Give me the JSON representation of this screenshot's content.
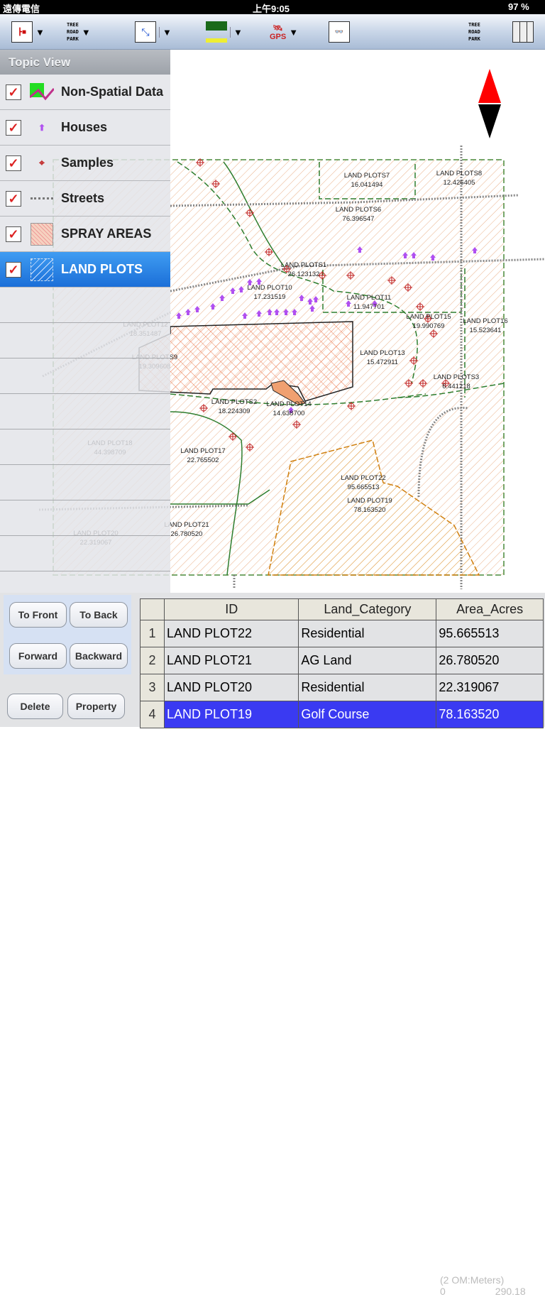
{
  "status": {
    "carrier": "遠傳電信",
    "time": "上午9:05",
    "battery": "97 %"
  },
  "toolbar": {
    "legend_items": [
      "TREE",
      "ROAD",
      "PARK"
    ],
    "gps_label": "GPS",
    "tools": [
      "topic-tree",
      "layer-legend",
      "zoom-extent",
      "measure",
      "gps",
      "query"
    ]
  },
  "sidebar": {
    "title": "Topic View",
    "items": [
      {
        "label": "Non-Spatial Data",
        "checked": true,
        "icon": "chart-icon"
      },
      {
        "label": "Houses",
        "checked": true,
        "icon": "house-icon"
      },
      {
        "label": "Samples",
        "checked": true,
        "icon": "sample-crosshair-icon"
      },
      {
        "label": "Streets",
        "checked": true,
        "icon": "dotted-line-icon"
      },
      {
        "label": "SPRAY AREAS",
        "checked": true,
        "icon": "crosshatch-icon"
      },
      {
        "label": "LAND PLOTS",
        "checked": true,
        "selected": true,
        "icon": "hatch-icon"
      }
    ]
  },
  "map": {
    "labels": [
      {
        "name": "LAND PLOTS7",
        "value": "16.041494"
      },
      {
        "name": "LAND PLOTS8",
        "value": "12.426405"
      },
      {
        "name": "LAND PLOTS6",
        "value": "76.396547"
      },
      {
        "name": "LAND PLOTS1",
        "value": "26.123132"
      },
      {
        "name": "LAND PLOT10",
        "value": "17.231519"
      },
      {
        "name": "LAND PLOT11",
        "value": "11.947701"
      },
      {
        "name": "LAND PLOT15",
        "value": "19.990769"
      },
      {
        "name": "LAND PLOT16",
        "value": "15.523641"
      },
      {
        "name": "LAND PLOT13",
        "value": "15.472911"
      },
      {
        "name": "LAND PLOTS3",
        "value": "6.441218"
      },
      {
        "name": "LAND PLOTS2",
        "value": "18.224309"
      },
      {
        "name": "LAND PLOT14",
        "value": "14.638700"
      },
      {
        "name": "LAND PLOT17",
        "value": "22.765502"
      },
      {
        "name": "LAND PLOT22",
        "value": "95.665513"
      },
      {
        "name": "LAND PLOT19",
        "value": "78.163520"
      },
      {
        "name": "LAND PLOT21",
        "value": "26.780520"
      },
      {
        "name": "LAND PLOT12",
        "value": "18.351487"
      },
      {
        "name": "LAND PLOTS9",
        "value": "19.309608"
      },
      {
        "name": "LAND PLOT18",
        "value": "44.398709"
      },
      {
        "name": "LAND PLOT20",
        "value": "22.319067"
      }
    ],
    "scale": {
      "unit": "(2 OM:Meters)",
      "min": "0",
      "max": "290.18"
    },
    "colors": {
      "hatch": "#e8a878",
      "boundary": "#2e7d2e",
      "spray": "#e86a3a",
      "golf": "#d98a1a",
      "house": "#b050f0",
      "sample": "#c02020"
    }
  },
  "buttons": {
    "to_front": "To Front",
    "to_back": "To Back",
    "forward": "Forward",
    "backward": "Backward",
    "delete": "Delete",
    "property": "Property"
  },
  "table": {
    "columns": [
      "ID",
      "Land_Category",
      "Area_Acres"
    ],
    "rows": [
      {
        "n": "1",
        "id": "LAND PLOT22",
        "category": "Residential",
        "area": "95.665513"
      },
      {
        "n": "2",
        "id": "LAND PLOT21",
        "category": "AG Land",
        "area": "26.780520"
      },
      {
        "n": "3",
        "id": "LAND PLOT20",
        "category": "Residential",
        "area": "22.319067"
      },
      {
        "n": "4",
        "id": "LAND PLOT19",
        "category": "Golf Course",
        "area": "78.163520",
        "selected": true
      }
    ]
  }
}
